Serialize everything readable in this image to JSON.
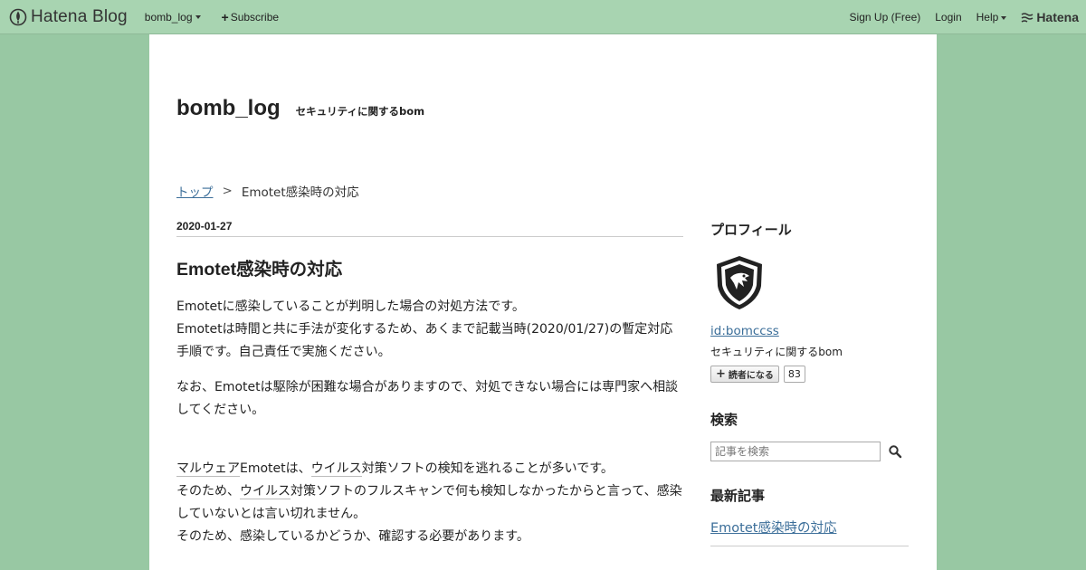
{
  "topbar": {
    "brand": "Hatena Blog",
    "blog_menu": "bomb_log",
    "subscribe": "Subscribe",
    "signup": "Sign Up (Free)",
    "login": "Login",
    "help": "Help",
    "hatena": "Hatena"
  },
  "blog": {
    "title": "bomb_log",
    "description": "セキュリティに関するbom"
  },
  "breadcrumb": {
    "top": "トップ",
    "separator": ">",
    "current": "Emotet感染時の対応"
  },
  "entry": {
    "date": "2020-01-27",
    "title": "Emotet感染時の対応",
    "p1_line1": "Emotetに感染していることが判明した場合の対処方法です。",
    "p1_line2": "Emotetは時間と共に手法が変化するため、あくまで記載当時(2020/01/27)の暫定対応手順です。自己責任で実施ください。",
    "p2": "なお、Emotetは駆除が困難な場合がありますので、対処できない場合には専門家へ相談してください。",
    "p3_kw1": "マルウェア",
    "p3_t1": "Emotetは、",
    "p3_kw2": "ウイルス",
    "p3_t2": "対策ソフトの検知を逃れることが多いです。",
    "p3_t3": "そのため、",
    "p3_kw3": "ウイルス",
    "p3_t4": "対策",
    "p3_kw4": "ソフト",
    "p3_t5": "のフルスキャンで何も検知しなかったからと言って、感染していないとは言い切れません。",
    "p3_t6": "そのため、感染しているかどうか、確認する必要があります。"
  },
  "sidebar": {
    "profile_heading": "プロフィール",
    "profile_id": "id:bomccss",
    "profile_desc": "セキュリティに関するbom",
    "subscribe_label": "読者になる",
    "subscriber_count": "83",
    "search_heading": "検索",
    "search_placeholder": "記事を検索",
    "recent_heading": "最新記事",
    "recent_items": [
      "Emotet感染時の対応"
    ]
  },
  "colors": {
    "background": "#98c8a3",
    "topbar": "#a8d4b1",
    "link": "#3b6e99"
  }
}
